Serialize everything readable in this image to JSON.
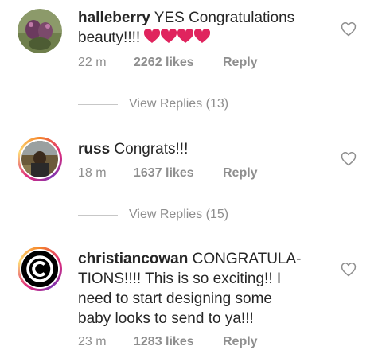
{
  "comments": [
    {
      "username": "halleberry",
      "text": "YES Congratulations beauty!!!!",
      "emoji": "red-heart x4",
      "time": "22 m",
      "likes": "2262 likes",
      "reply_label": "Reply",
      "view_replies": "View Replies (13)"
    },
    {
      "username": "russ",
      "text": "Congrats!!!",
      "time": "18 m",
      "likes": "1637 likes",
      "reply_label": "Reply",
      "view_replies": "View Replies (15)"
    },
    {
      "username": "christiancowan",
      "text_line1": "CONGRATULA-",
      "text_line2": "TIONS!!!! This is so exciting!! I",
      "text_line3": "need to start designing some",
      "text_line4": "baby looks to send to ya!!!",
      "time": "23 m",
      "likes": "1283 likes",
      "reply_label": "Reply"
    }
  ],
  "colors": {
    "text": "#262626",
    "meta": "#8e8e8e",
    "heart_emoji": "#e0245e",
    "divider": "#c7c7c7"
  },
  "icons": [
    "like-heart-outline-icon",
    "red-heart-emoji"
  ]
}
